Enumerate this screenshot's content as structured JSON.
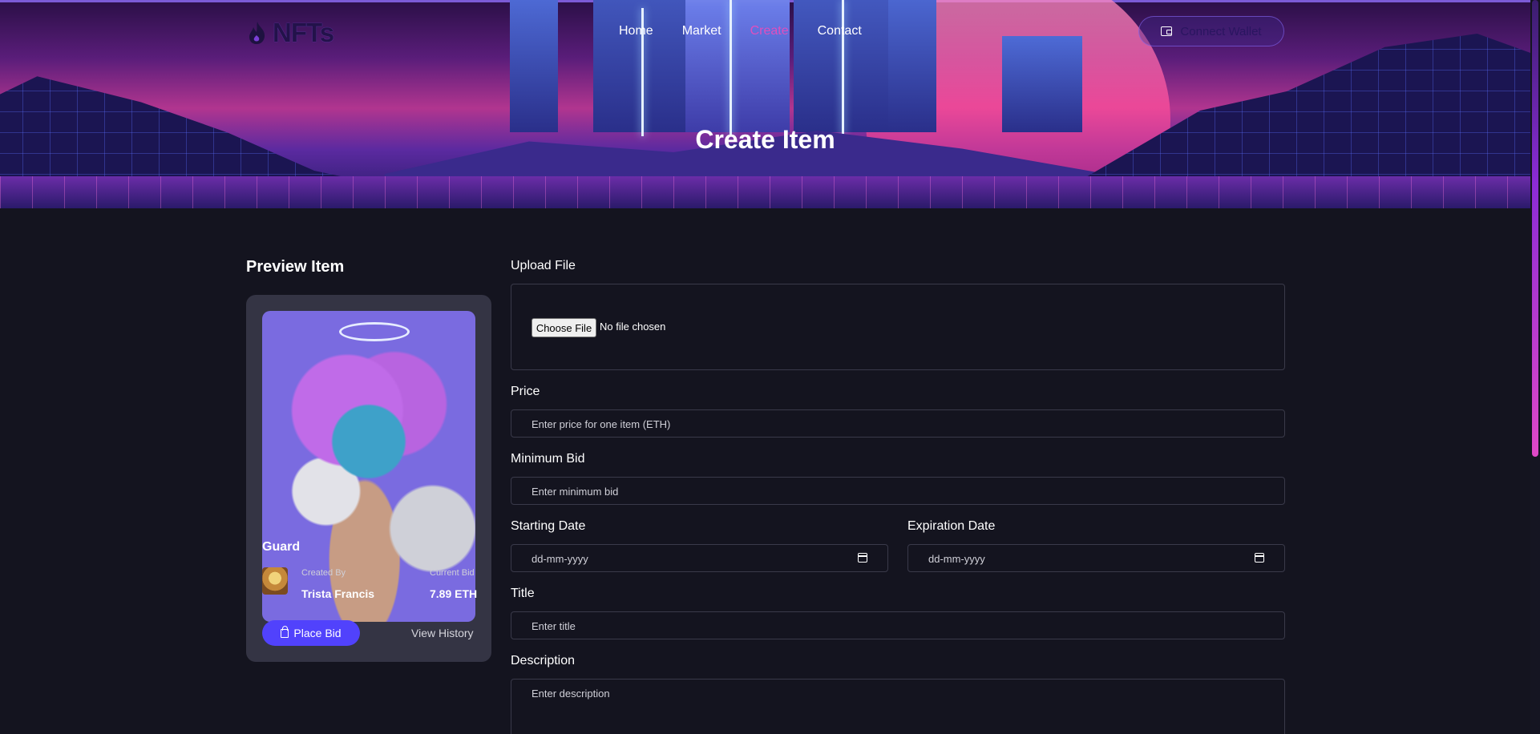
{
  "header": {
    "logo_text": "NFTs",
    "nav": [
      "Home",
      "Market",
      "Create",
      "Contact"
    ],
    "active_nav": "Create",
    "connect_label": "Connect Wallet",
    "page_title": "Create Item"
  },
  "preview": {
    "heading": "Preview Item",
    "item_title": "Guard",
    "created_by_label": "Created By",
    "creator_name": "Trista Francis",
    "current_bid_label": "Current Bid",
    "current_bid_value": "7.89 ETH",
    "place_bid_label": "Place Bid",
    "view_history_label": "View History"
  },
  "form": {
    "upload_label": "Upload File",
    "choose_file_label": "Choose File",
    "no_file_text": "No file chosen",
    "price_label": "Price",
    "price_placeholder": "Enter price for one item (ETH)",
    "min_bid_label": "Minimum Bid",
    "min_bid_placeholder": "Enter minimum bid",
    "start_date_label": "Starting Date",
    "start_date_placeholder": "dd-mm-yyyy",
    "expiration_date_label": "Expiration Date",
    "expiration_date_placeholder": "dd-mm-yyyy",
    "title_label": "Title",
    "title_placeholder": "Enter title",
    "description_label": "Description",
    "description_placeholder": "Enter description"
  },
  "colors": {
    "background": "#14141f",
    "card": "#343444",
    "accent": "#5142fc",
    "active_nav": "#e04fbe"
  }
}
